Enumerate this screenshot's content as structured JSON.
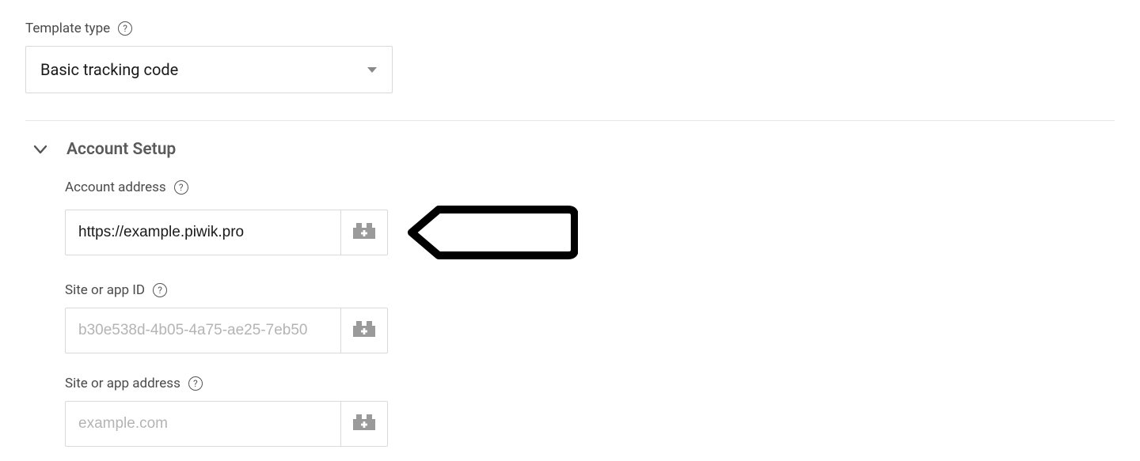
{
  "template": {
    "label": "Template type",
    "selected": "Basic tracking code"
  },
  "section": {
    "title": "Account Setup"
  },
  "fields": {
    "account_address": {
      "label": "Account address",
      "value": "https://example.piwik.pro",
      "placeholder": ""
    },
    "site_id": {
      "label": "Site or app ID",
      "value": "",
      "placeholder": "b30e538d-4b05-4a75-ae25-7eb50"
    },
    "site_address": {
      "label": "Site or app address",
      "value": "",
      "placeholder": "example.com"
    }
  }
}
